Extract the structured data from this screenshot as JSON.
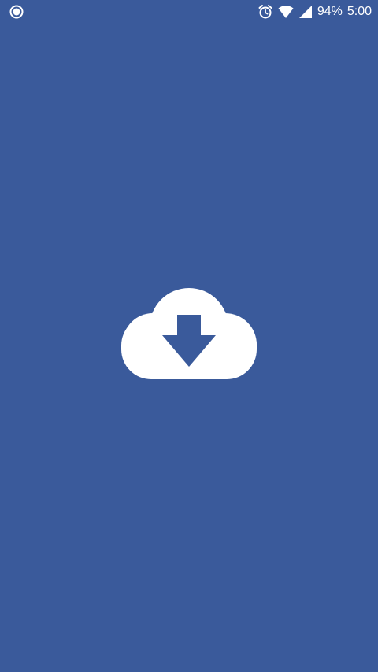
{
  "status_bar": {
    "left_icon": "circle-notification-icon",
    "alarm_icon": "alarm-clock-icon",
    "wifi_icon": "wifi-icon",
    "signal_icon": "cell-signal-icon",
    "battery_text": "94%",
    "time_text": "5:00"
  },
  "splash": {
    "logo_icon": "cloud-download-icon"
  },
  "colors": {
    "background": "#3a5a9b",
    "foreground": "#ffffff"
  }
}
